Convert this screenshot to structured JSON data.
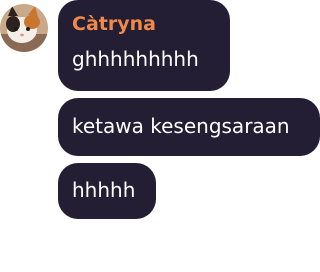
{
  "avatar": {
    "icon": "cat-avatar-icon"
  },
  "sender": {
    "name": "Càtryna",
    "color": "#f08a4b"
  },
  "messages": [
    {
      "text": "ghhhhhhhhh"
    },
    {
      "text": "ketawa kesengsaraan"
    },
    {
      "text": "hhhhh"
    }
  ],
  "colors": {
    "bubble": "#231e33",
    "text": "#ffffff",
    "background": "#ffffff"
  }
}
